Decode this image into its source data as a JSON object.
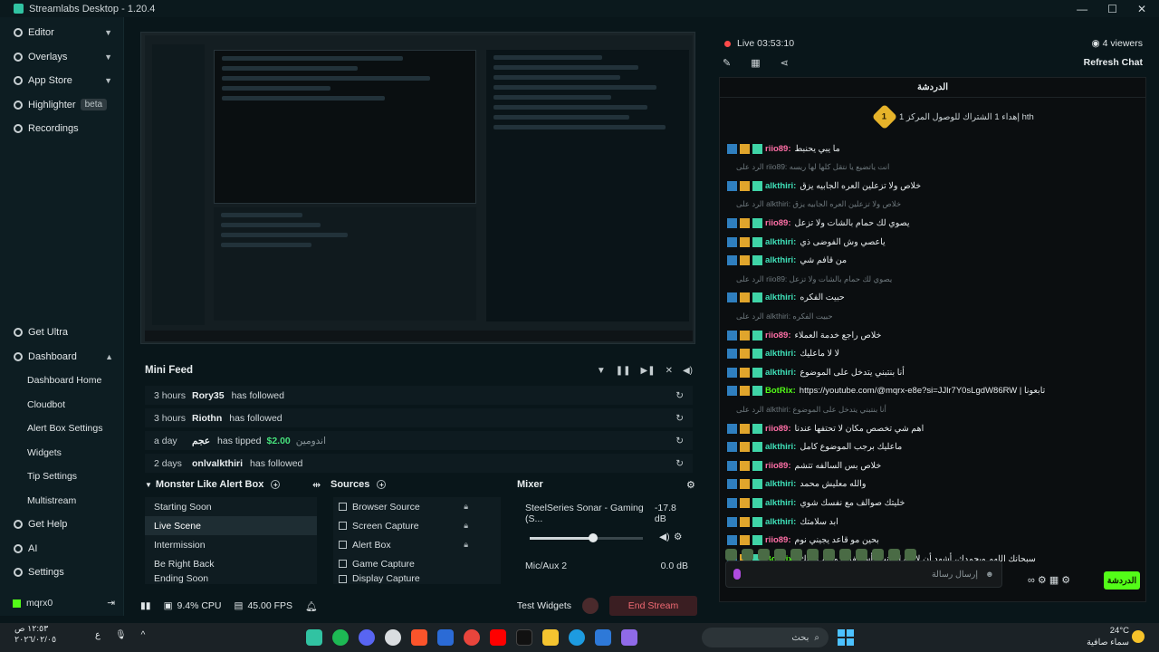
{
  "titlebar": {
    "title": "Streamlabs Desktop - 1.20.4",
    "ctrls": [
      "—",
      "☐",
      "✕"
    ]
  },
  "sidebar": {
    "top": [
      {
        "label": "Editor"
      },
      {
        "label": "Overlays"
      },
      {
        "label": "App Store"
      },
      {
        "label": "Highlighter",
        "badge": "beta"
      },
      {
        "label": "Recordings"
      }
    ],
    "bottom": [
      "Get Ultra",
      "Dashboard"
    ],
    "dashboard_sub": [
      "Dashboard Home",
      "Cloudbot",
      "Alert Box Settings",
      "Widgets",
      "Tip Settings",
      "Multistream"
    ],
    "tail": [
      "Get Help",
      "AI",
      "Settings"
    ],
    "user": "mqrx0"
  },
  "minifeed": {
    "title": "Mini Feed",
    "rows": [
      {
        "time": "3 hours",
        "who": "Rory35",
        "act": "has followed",
        "amt": "",
        "msg": ""
      },
      {
        "time": "3 hours",
        "who": "Riothn",
        "act": "has followed",
        "amt": "",
        "msg": ""
      },
      {
        "time": "a day",
        "who": "عجم",
        "act": "has tipped",
        "amt": "$2.00",
        "msg": "اندومين"
      },
      {
        "time": "2 days",
        "who": "onlvalkthiri",
        "act": "has followed",
        "amt": "",
        "msg": ""
      }
    ]
  },
  "dock": {
    "scenes_title": "Monster Like Alert Box",
    "scenes": [
      "Starting Soon",
      "Live Scene",
      "Intermission",
      "Be Right Back",
      "Ending Soon"
    ],
    "sources_title": "Sources",
    "sources": [
      "Browser Source",
      "Screen Capture",
      "Alert Box",
      "Game Capture",
      "Display Capture"
    ],
    "mixer_title": "Mixer",
    "mixer": [
      {
        "name": "SteelSeries Sonar - Gaming (S...",
        "db": "-17.8 dB"
      },
      {
        "name": "Mic/Aux 2",
        "db": "0.0 dB"
      }
    ]
  },
  "status": {
    "cpu": "9.4% CPU",
    "fps": "45.00 FPS",
    "test": "Test Widgets",
    "end": "End Stream"
  },
  "live": {
    "label": "Live 03:53:10",
    "viewers": "4 viewers",
    "refresh": "Refresh Chat"
  },
  "chat": {
    "header": "الدردشة",
    "pinned_num": "1",
    "pinned_text": "إهداء 1 الشتراك للوصول المركز 1 hth",
    "lines": [
      {
        "type": "msg",
        "name": "riio89",
        "color": "#ff6fa6",
        "text": "ما يبي يحنبط"
      },
      {
        "type": "reply",
        "text": "الرد على riio89: انت ياتضيع يا نتقل كلها لها ريسه"
      },
      {
        "type": "msg",
        "name": "alkthiri",
        "color": "#3fe0b8",
        "text": "خلاص ولا تزعلين العره الجابيه يزق"
      },
      {
        "type": "reply",
        "text": "الرد على alkthiri: خلاص ولا تزعلين العره الجابيه يزق"
      },
      {
        "type": "msg",
        "name": "riio89",
        "color": "#ff6fa6",
        "text": "يصوي لك حمام بالشات ولا تزعل"
      },
      {
        "type": "msg",
        "name": "alkthiri",
        "color": "#3fe0b8",
        "text": "ياعصي وش الفوضى ذي"
      },
      {
        "type": "msg",
        "name": "alkthiri",
        "color": "#3fe0b8",
        "text": "من قافم شي"
      },
      {
        "type": "reply",
        "text": "الرد على riio89: يصوي لك حمام بالشات ولا تزعل"
      },
      {
        "type": "msg",
        "name": "alkthiri",
        "color": "#3fe0b8",
        "text": "حبيت الفكره"
      },
      {
        "type": "reply",
        "text": "الرد على alkthiri: حبيت الفكره"
      },
      {
        "type": "msg",
        "name": "riio89",
        "color": "#ff6fa6",
        "text": "خلاص راجع خدمة العملاء"
      },
      {
        "type": "msg",
        "name": "alkthiri",
        "color": "#3fe0b8",
        "text": "لا لا ماعليك"
      },
      {
        "type": "msg",
        "name": "alkthiri",
        "color": "#3fe0b8",
        "text": "أنا بنتبني يتدخل على الموضوع"
      },
      {
        "type": "msg",
        "name": "BotRix",
        "color": "#53fc18",
        "text": "https://youtube.com/@mqrx-e8e?si=JJlr7Y0sLgdW86RW | تابعونا"
      },
      {
        "type": "reply",
        "text": "الرد على alkthiri: أنا بنتبني يتدخل على الموضوع"
      },
      {
        "type": "msg",
        "name": "riio89",
        "color": "#ff6fa6",
        "text": "اهم شي تخصص مكان لا تحتفها عندنا"
      },
      {
        "type": "msg",
        "name": "alkthiri",
        "color": "#3fe0b8",
        "text": "ماعليك برجب الموضوع كامل"
      },
      {
        "type": "msg",
        "name": "riio89",
        "color": "#ff6fa6",
        "text": "خلاص بس السالفه تتشم"
      },
      {
        "type": "msg",
        "name": "alkthiri",
        "color": "#3fe0b8",
        "text": "والله معليش محمد"
      },
      {
        "type": "msg",
        "name": "alkthiri",
        "color": "#3fe0b8",
        "text": "خليتك صوالف مع نفسك شوي"
      },
      {
        "type": "msg",
        "name": "alkthiri",
        "color": "#3fe0b8",
        "text": "ابد سلامتك"
      },
      {
        "type": "msg",
        "name": "riio89",
        "color": "#ff6fa6",
        "text": "بحين مو قاعد يجيني نوم"
      },
      {
        "type": "msg",
        "name": "BotRix",
        "color": "#53fc18",
        "text": "سبحانك اللهم وبحمدك، أشهد أن لا إله إلا أنت، أستغفرك وأتوب إليك"
      }
    ],
    "input_placeholder": "إرسال رسالة",
    "send": "الدردشة"
  },
  "taskbar": {
    "time": "١٢:٥٣ ص",
    "date": "٢٠٢٦/٠٢/٠٥",
    "search": "بحث",
    "temp": "24°C",
    "weather": "سماء صافية",
    "lang": "ع"
  }
}
